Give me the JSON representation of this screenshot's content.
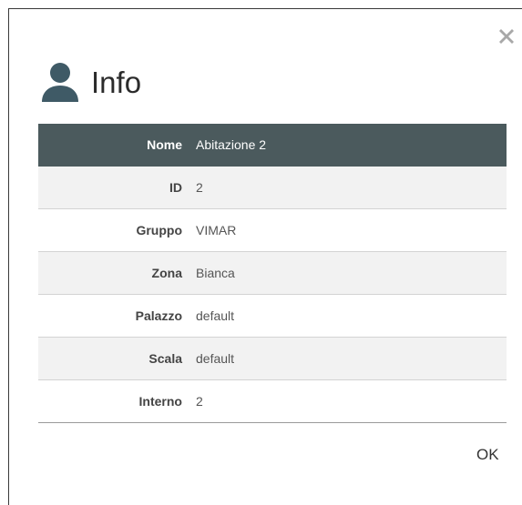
{
  "dialog": {
    "title": "Info",
    "ok_label": "OK",
    "close_icon": "close-icon",
    "header_icon": "user-icon"
  },
  "details": {
    "rows": [
      {
        "label": "Nome",
        "value": "Abitazione 2"
      },
      {
        "label": "ID",
        "value": "2"
      },
      {
        "label": "Gruppo",
        "value": "VIMAR"
      },
      {
        "label": "Zona",
        "value": "Bianca"
      },
      {
        "label": "Palazzo",
        "value": "default"
      },
      {
        "label": "Scala",
        "value": "default"
      },
      {
        "label": "Interno",
        "value": "2"
      }
    ]
  },
  "colors": {
    "header_row": "#4b5a5d",
    "icon": "#3f5a66",
    "stripe": "#f2f2f2"
  }
}
